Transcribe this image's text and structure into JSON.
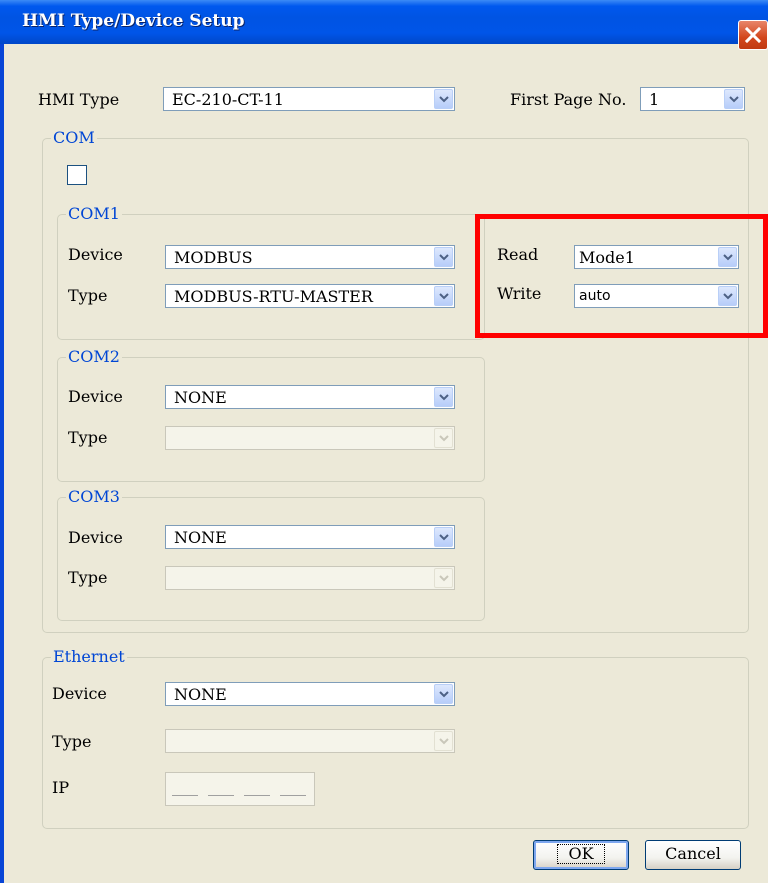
{
  "window": {
    "title": "HMI Type/Device Setup"
  },
  "top": {
    "hmi_type_label": "HMI Type",
    "hmi_type_value": "EC-210-CT-11",
    "first_page_label": "First Page No.",
    "first_page_value": "1"
  },
  "com": {
    "title": "COM",
    "com1": {
      "title": "COM1",
      "device_label": "Device",
      "device_value": "MODBUS",
      "type_label": "Type",
      "type_value": "MODBUS-RTU-MASTER",
      "read_label": "Read",
      "read_value": "Mode1",
      "write_label": "Write",
      "write_value": "auto"
    },
    "com2": {
      "title": "COM2",
      "device_label": "Device",
      "device_value": "NONE",
      "type_label": "Type",
      "type_value": ""
    },
    "com3": {
      "title": "COM3",
      "device_label": "Device",
      "device_value": "NONE",
      "type_label": "Type",
      "type_value": ""
    }
  },
  "ethernet": {
    "title": "Ethernet",
    "device_label": "Device",
    "device_value": "NONE",
    "type_label": "Type",
    "type_value": "",
    "ip_label": "IP"
  },
  "buttons": {
    "ok_label": "OK",
    "cancel_label": "Cancel"
  },
  "colors": {
    "title_bar": "#0054e3",
    "group_title": "#0046d5",
    "highlight": "#ff0000",
    "dialog_bg": "#ece9d8"
  }
}
